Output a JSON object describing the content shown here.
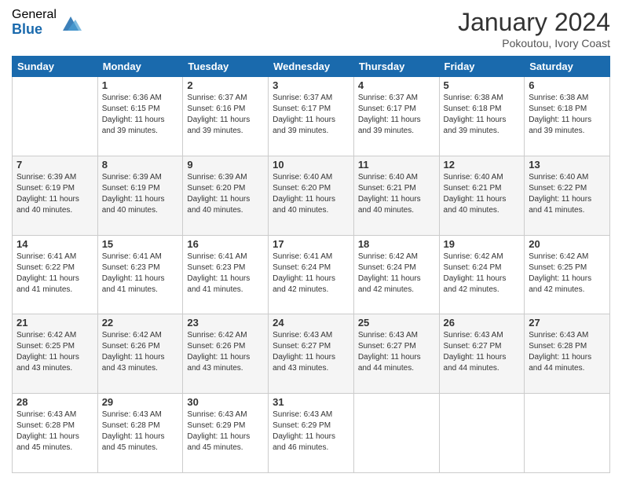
{
  "logo": {
    "general": "General",
    "blue": "Blue"
  },
  "header": {
    "title": "January 2024",
    "subtitle": "Pokoutou, Ivory Coast"
  },
  "weekdays": [
    "Sunday",
    "Monday",
    "Tuesday",
    "Wednesday",
    "Thursday",
    "Friday",
    "Saturday"
  ],
  "weeks": [
    [
      {
        "day": "",
        "sunrise": "",
        "sunset": "",
        "daylight": ""
      },
      {
        "day": "1",
        "sunrise": "6:36 AM",
        "sunset": "6:15 PM",
        "daylight": "11 hours and 39 minutes."
      },
      {
        "day": "2",
        "sunrise": "6:37 AM",
        "sunset": "6:16 PM",
        "daylight": "11 hours and 39 minutes."
      },
      {
        "day": "3",
        "sunrise": "6:37 AM",
        "sunset": "6:17 PM",
        "daylight": "11 hours and 39 minutes."
      },
      {
        "day": "4",
        "sunrise": "6:37 AM",
        "sunset": "6:17 PM",
        "daylight": "11 hours and 39 minutes."
      },
      {
        "day": "5",
        "sunrise": "6:38 AM",
        "sunset": "6:18 PM",
        "daylight": "11 hours and 39 minutes."
      },
      {
        "day": "6",
        "sunrise": "6:38 AM",
        "sunset": "6:18 PM",
        "daylight": "11 hours and 39 minutes."
      }
    ],
    [
      {
        "day": "7",
        "sunrise": "6:39 AM",
        "sunset": "6:19 PM",
        "daylight": "11 hours and 40 minutes."
      },
      {
        "day": "8",
        "sunrise": "6:39 AM",
        "sunset": "6:19 PM",
        "daylight": "11 hours and 40 minutes."
      },
      {
        "day": "9",
        "sunrise": "6:39 AM",
        "sunset": "6:20 PM",
        "daylight": "11 hours and 40 minutes."
      },
      {
        "day": "10",
        "sunrise": "6:40 AM",
        "sunset": "6:20 PM",
        "daylight": "11 hours and 40 minutes."
      },
      {
        "day": "11",
        "sunrise": "6:40 AM",
        "sunset": "6:21 PM",
        "daylight": "11 hours and 40 minutes."
      },
      {
        "day": "12",
        "sunrise": "6:40 AM",
        "sunset": "6:21 PM",
        "daylight": "11 hours and 40 minutes."
      },
      {
        "day": "13",
        "sunrise": "6:40 AM",
        "sunset": "6:22 PM",
        "daylight": "11 hours and 41 minutes."
      }
    ],
    [
      {
        "day": "14",
        "sunrise": "6:41 AM",
        "sunset": "6:22 PM",
        "daylight": "11 hours and 41 minutes."
      },
      {
        "day": "15",
        "sunrise": "6:41 AM",
        "sunset": "6:23 PM",
        "daylight": "11 hours and 41 minutes."
      },
      {
        "day": "16",
        "sunrise": "6:41 AM",
        "sunset": "6:23 PM",
        "daylight": "11 hours and 41 minutes."
      },
      {
        "day": "17",
        "sunrise": "6:41 AM",
        "sunset": "6:24 PM",
        "daylight": "11 hours and 42 minutes."
      },
      {
        "day": "18",
        "sunrise": "6:42 AM",
        "sunset": "6:24 PM",
        "daylight": "11 hours and 42 minutes."
      },
      {
        "day": "19",
        "sunrise": "6:42 AM",
        "sunset": "6:24 PM",
        "daylight": "11 hours and 42 minutes."
      },
      {
        "day": "20",
        "sunrise": "6:42 AM",
        "sunset": "6:25 PM",
        "daylight": "11 hours and 42 minutes."
      }
    ],
    [
      {
        "day": "21",
        "sunrise": "6:42 AM",
        "sunset": "6:25 PM",
        "daylight": "11 hours and 43 minutes."
      },
      {
        "day": "22",
        "sunrise": "6:42 AM",
        "sunset": "6:26 PM",
        "daylight": "11 hours and 43 minutes."
      },
      {
        "day": "23",
        "sunrise": "6:42 AM",
        "sunset": "6:26 PM",
        "daylight": "11 hours and 43 minutes."
      },
      {
        "day": "24",
        "sunrise": "6:43 AM",
        "sunset": "6:27 PM",
        "daylight": "11 hours and 43 minutes."
      },
      {
        "day": "25",
        "sunrise": "6:43 AM",
        "sunset": "6:27 PM",
        "daylight": "11 hours and 44 minutes."
      },
      {
        "day": "26",
        "sunrise": "6:43 AM",
        "sunset": "6:27 PM",
        "daylight": "11 hours and 44 minutes."
      },
      {
        "day": "27",
        "sunrise": "6:43 AM",
        "sunset": "6:28 PM",
        "daylight": "11 hours and 44 minutes."
      }
    ],
    [
      {
        "day": "28",
        "sunrise": "6:43 AM",
        "sunset": "6:28 PM",
        "daylight": "11 hours and 45 minutes."
      },
      {
        "day": "29",
        "sunrise": "6:43 AM",
        "sunset": "6:28 PM",
        "daylight": "11 hours and 45 minutes."
      },
      {
        "day": "30",
        "sunrise": "6:43 AM",
        "sunset": "6:29 PM",
        "daylight": "11 hours and 45 minutes."
      },
      {
        "day": "31",
        "sunrise": "6:43 AM",
        "sunset": "6:29 PM",
        "daylight": "11 hours and 46 minutes."
      },
      {
        "day": "",
        "sunrise": "",
        "sunset": "",
        "daylight": ""
      },
      {
        "day": "",
        "sunrise": "",
        "sunset": "",
        "daylight": ""
      },
      {
        "day": "",
        "sunrise": "",
        "sunset": "",
        "daylight": ""
      }
    ]
  ]
}
